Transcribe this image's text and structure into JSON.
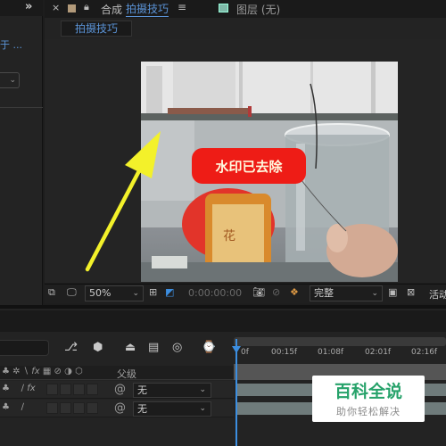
{
  "left_panel": {
    "link_text": "于 ...",
    "dropdown_chevron": "chevron-down"
  },
  "comp_panel": {
    "close_glyph": "×",
    "tab_type": "合成",
    "comp_name": "拍摄技巧",
    "menu_glyph": "≡",
    "layer_tab": "图层 (无)",
    "subtab": "拍摄技巧"
  },
  "overlay": {
    "callout": "水印已去除",
    "arrow_color": "#f3f12a",
    "callout_color": "#ee1c16"
  },
  "viewer_toolbar": {
    "zoom": "50%",
    "timecode": "0:00:00:00",
    "resolution": "完整",
    "active_camera": "活动"
  },
  "timeline": {
    "ruler_ticks": [
      "0f",
      "00:15f",
      "01:08f",
      "02:01f",
      "02:16f"
    ],
    "column_parent": "父级",
    "rows": [
      {
        "parent": "无"
      },
      {
        "parent": "无"
      }
    ]
  },
  "watermark": {
    "main": "百科全说",
    "sub": "助你轻松解决",
    "color": "#26a26a"
  }
}
